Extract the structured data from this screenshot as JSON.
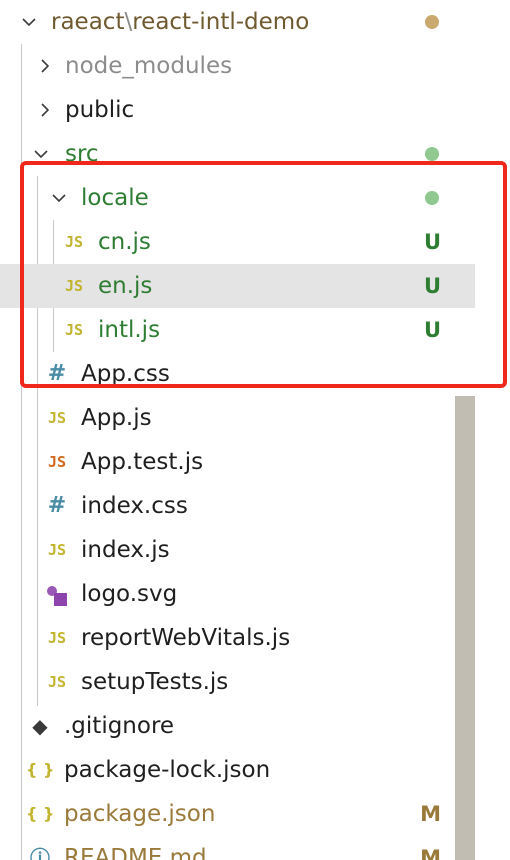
{
  "colors": {
    "selected_row": "#e4e4e4",
    "js_icon": "#c2b42e",
    "test_js_icon": "#d2691e",
    "css_icon": "#4a8ca5",
    "svg_icon": "#9b59b6",
    "json_icon": "#c2b42e",
    "git_icon": "#3a3a3a",
    "untracked_text": "#2e7d32",
    "modified_text": "#9a7a3a",
    "dot_modified": "#c9a96e",
    "dot_untracked": "#8fc98f",
    "annotation_box": "#f0271b"
  },
  "tree": {
    "root": {
      "workspace": "raeact",
      "separator": "\\",
      "project": "react-intl-demo"
    },
    "node_modules": {
      "label": "node_modules"
    },
    "public": {
      "label": "public"
    },
    "src": {
      "label": "src"
    },
    "locale": {
      "label": "locale"
    },
    "files": {
      "cn_js": {
        "label": "cn.js",
        "icon_text": "JS",
        "badge": "U"
      },
      "en_js": {
        "label": "en.js",
        "icon_text": "JS",
        "badge": "U"
      },
      "intl_js": {
        "label": "intl.js",
        "icon_text": "JS",
        "badge": "U"
      },
      "app_css": {
        "label": "App.css",
        "icon_text": "#"
      },
      "app_js": {
        "label": "App.js",
        "icon_text": "JS"
      },
      "app_test_js": {
        "label": "App.test.js",
        "icon_text": "JS"
      },
      "index_css": {
        "label": "index.css",
        "icon_text": "#"
      },
      "index_js": {
        "label": "index.js",
        "icon_text": "JS"
      },
      "logo_svg": {
        "label": "logo.svg"
      },
      "report_web_vitals": {
        "label": "reportWebVitals.js",
        "icon_text": "JS"
      },
      "setup_tests": {
        "label": "setupTests.js",
        "icon_text": "JS"
      },
      "gitignore": {
        "label": ".gitignore",
        "icon_text": "◆"
      },
      "package_lock": {
        "label": "package-lock.json",
        "icon_text": "{ }"
      },
      "package_json": {
        "label": "package.json",
        "icon_text": "{ }",
        "badge": "M"
      },
      "readme": {
        "label": "README.md",
        "icon_text": "ⓘ",
        "badge": "M"
      }
    }
  }
}
